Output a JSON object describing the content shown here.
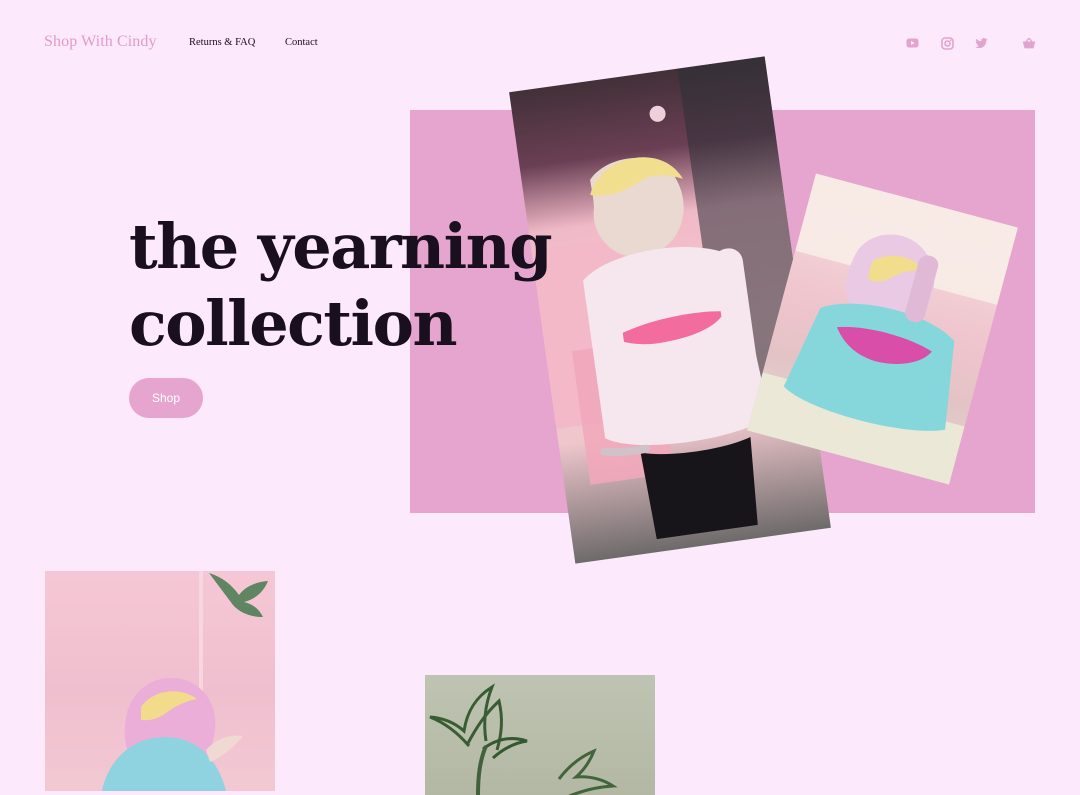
{
  "header": {
    "brand": "Shop With Cindy",
    "nav": {
      "returns": "Returns & FAQ",
      "contact": "Contact"
    },
    "icons": [
      "youtube-icon",
      "instagram-icon",
      "twitter-icon",
      "cart-icon"
    ]
  },
  "hero": {
    "title_line1": "the yearning",
    "title_line2": "collection",
    "cta": "Shop"
  },
  "colors": {
    "background": "#fde9fc",
    "accent_pink": "#e6a5ce",
    "text_dark": "#1a0f1f"
  }
}
